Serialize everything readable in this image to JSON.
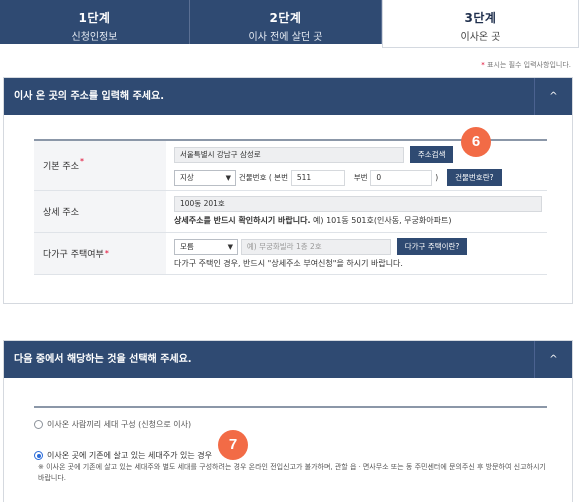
{
  "steps": [
    {
      "num": "1단계",
      "label": "신청인정보"
    },
    {
      "num": "2단계",
      "label": "이사 전에 살던 곳"
    },
    {
      "num": "3단계",
      "label": "이사온 곳"
    }
  ],
  "required_note": "표시는 필수 입력사항입니다.",
  "required_star": "*",
  "address_section": {
    "title": "이사 온 곳의 주소를 입력해 주세요.",
    "toggle": "^",
    "basic": {
      "label": "기본 주소",
      "address_value": "서울특별시 강남구 삼성로",
      "search_button": "주소검색",
      "type_select": "지상",
      "building_label": "건물번호 ( 본번",
      "main_no": "511",
      "sub_label": "부번",
      "sub_no": "0",
      "close_paren": ")",
      "building_name_button": "건물번호란?"
    },
    "detail": {
      "label": "상세 주소",
      "value": "100동 201호",
      "help_bold": "상세주소를 반드시 확인하시기 바랍니다.",
      "help_rest": " 예) 101동 501호(인사동, 무궁화아파트)"
    },
    "multi": {
      "label": "다가구 주택여부",
      "select": "모름",
      "placeholder": "예) 무궁화빌라 1층 2호",
      "button": "다가구 주택이란?",
      "help": "다가구 주택인 경우, 반드시 \"상세주소 부여신청\"을 하시기 바랍니다."
    }
  },
  "household_section": {
    "title": "다음 중에서 해당하는 것을 선택해 주세요.",
    "toggle": "^",
    "option_a": "이사온 사람끼리 세대 구성 (신청으로 이사)",
    "option_b": "이사온 곳에 기존에 살고 있는 세대주가 있는 경우",
    "note": "※ 이사온 곳에 기존에 살고 있는 세대주와 별도 세대를 구성하려는 경우 온라인 전입신고가 불가하며, 관할 읍ㆍ면사무소 또는 동 주민센터에 문의주신 후 방문하여 신고하시기 바랍니다."
  },
  "callouts": {
    "six": "6",
    "seven": "7"
  },
  "colors": {
    "navy": "#2f4a72",
    "badge": "#f26b46",
    "required": "#e0002a"
  }
}
